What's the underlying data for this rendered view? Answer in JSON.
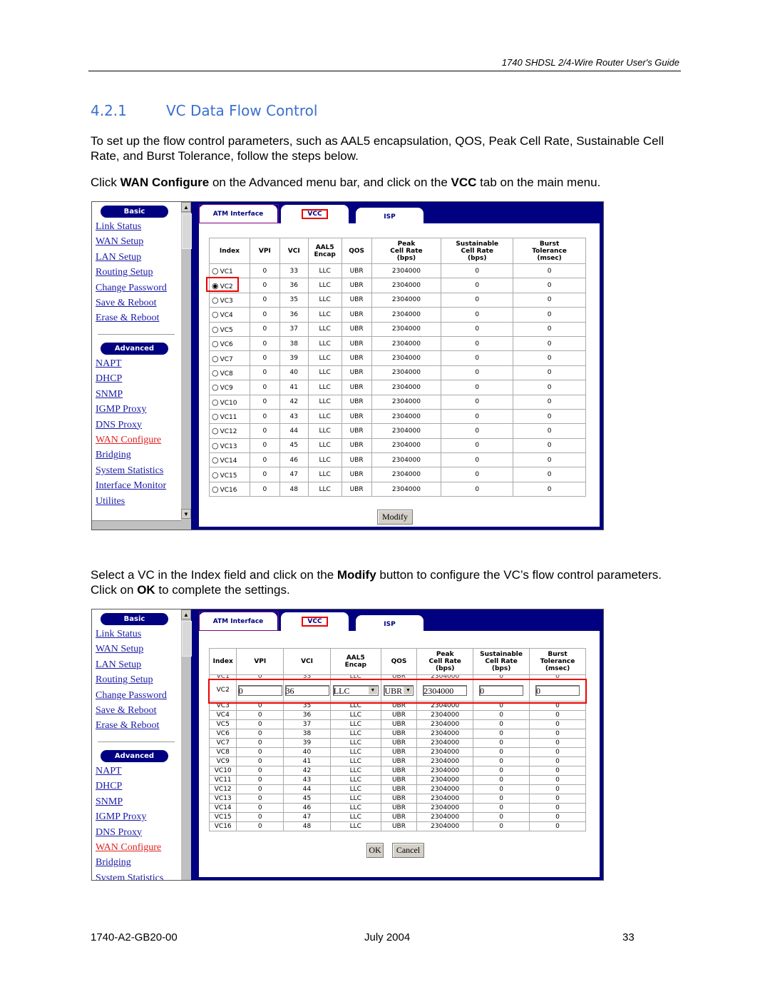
{
  "header": {
    "running_title": "1740 SHDSL 2/4-Wire Router User's Guide"
  },
  "section": {
    "number": "4.2.1",
    "title": "VC Data Flow Control"
  },
  "paragraphs": {
    "p1": "To set up the flow control parameters, such as AAL5 encapsulation, QOS, Peak Cell Rate, Sustainable Cell Rate, and Burst Tolerance, follow the steps below.",
    "p2_a": "Click ",
    "p2_b": "WAN Configure",
    "p2_c": " on the Advanced menu bar, and click on the ",
    "p2_d": "VCC",
    "p2_e": " tab on the main menu.",
    "p3_a": "Select a VC in the Index field and click on the ",
    "p3_b": "Modify",
    "p3_c": " button to configure the VC’s flow control parameters. Click on ",
    "p3_d": "OK",
    "p3_e": " to complete the settings."
  },
  "sidebar": {
    "basic_label": "Basic",
    "basic_items": [
      "Link Status",
      "WAN Setup",
      "LAN Setup",
      "Routing Setup",
      "Change Password",
      "Save & Reboot",
      "Erase & Reboot"
    ],
    "advanced_label": "Advanced",
    "advanced_items": [
      "NAPT",
      "DHCP",
      "SNMP",
      "IGMP Proxy",
      "DNS Proxy",
      "WAN Configure",
      "Bridging",
      "System Statistics",
      "Interface Monitor",
      "Utilites"
    ],
    "active_item": "WAN Configure"
  },
  "tabs": [
    "ATM Interface",
    "VCC",
    "ISP"
  ],
  "table": {
    "headers": [
      "Index",
      "VPI",
      "VCI",
      "AAL5\nEncap",
      "QOS",
      "Peak\nCell Rate\n(bps)",
      "Sustainable\nCell Rate\n(bps)",
      "Burst\nTolerance\n(msec)"
    ],
    "selected": "VC2",
    "rows": [
      [
        "VC1",
        "0",
        "33",
        "LLC",
        "UBR",
        "2304000",
        "0",
        "0"
      ],
      [
        "VC2",
        "0",
        "36",
        "LLC",
        "UBR",
        "2304000",
        "0",
        "0"
      ],
      [
        "VC3",
        "0",
        "35",
        "LLC",
        "UBR",
        "2304000",
        "0",
        "0"
      ],
      [
        "VC4",
        "0",
        "36",
        "LLC",
        "UBR",
        "2304000",
        "0",
        "0"
      ],
      [
        "VC5",
        "0",
        "37",
        "LLC",
        "UBR",
        "2304000",
        "0",
        "0"
      ],
      [
        "VC6",
        "0",
        "38",
        "LLC",
        "UBR",
        "2304000",
        "0",
        "0"
      ],
      [
        "VC7",
        "0",
        "39",
        "LLC",
        "UBR",
        "2304000",
        "0",
        "0"
      ],
      [
        "VC8",
        "0",
        "40",
        "LLC",
        "UBR",
        "2304000",
        "0",
        "0"
      ],
      [
        "VC9",
        "0",
        "41",
        "LLC",
        "UBR",
        "2304000",
        "0",
        "0"
      ],
      [
        "VC10",
        "0",
        "42",
        "LLC",
        "UBR",
        "2304000",
        "0",
        "0"
      ],
      [
        "VC11",
        "0",
        "43",
        "LLC",
        "UBR",
        "2304000",
        "0",
        "0"
      ],
      [
        "VC12",
        "0",
        "44",
        "LLC",
        "UBR",
        "2304000",
        "0",
        "0"
      ],
      [
        "VC13",
        "0",
        "45",
        "LLC",
        "UBR",
        "2304000",
        "0",
        "0"
      ],
      [
        "VC14",
        "0",
        "46",
        "LLC",
        "UBR",
        "2304000",
        "0",
        "0"
      ],
      [
        "VC15",
        "0",
        "47",
        "LLC",
        "UBR",
        "2304000",
        "0",
        "0"
      ],
      [
        "VC16",
        "0",
        "48",
        "LLC",
        "UBR",
        "2304000",
        "0",
        "0"
      ]
    ]
  },
  "edit_row": {
    "index": "VC2",
    "vpi": "0",
    "vci": "36",
    "encap": "LLC",
    "qos": "UBR",
    "peak": "2304000",
    "sustainable": "0",
    "burst": "0"
  },
  "buttons": {
    "modify": "Modify",
    "ok": "OK",
    "cancel": "Cancel"
  },
  "footer": {
    "doc_id": "1740-A2-GB20-00",
    "date": "July 2004",
    "page": "33"
  },
  "colors": {
    "heading": "#3a6fd0",
    "navy": "#000080",
    "highlight": "#e00000"
  }
}
